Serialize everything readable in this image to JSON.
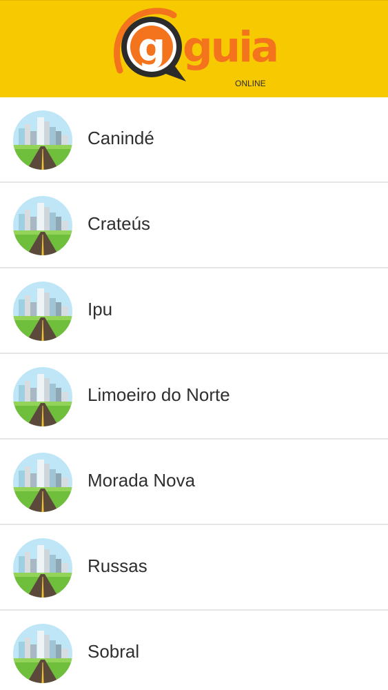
{
  "header": {
    "logo_word": "guia",
    "logo_badge": "g",
    "logo_sub": "ONLINE",
    "background": "#f7c900",
    "accent": "#f4731d"
  },
  "cities": {
    "items": [
      {
        "label": "Canindé",
        "icon": "city-road-icon"
      },
      {
        "label": "Crateús",
        "icon": "city-road-icon"
      },
      {
        "label": "Ipu",
        "icon": "city-road-icon"
      },
      {
        "label": "Limoeiro do Norte",
        "icon": "city-road-icon"
      },
      {
        "label": "Morada Nova",
        "icon": "city-road-icon"
      },
      {
        "label": "Russas",
        "icon": "city-road-icon"
      },
      {
        "label": "Sobral",
        "icon": "city-road-icon"
      }
    ]
  }
}
